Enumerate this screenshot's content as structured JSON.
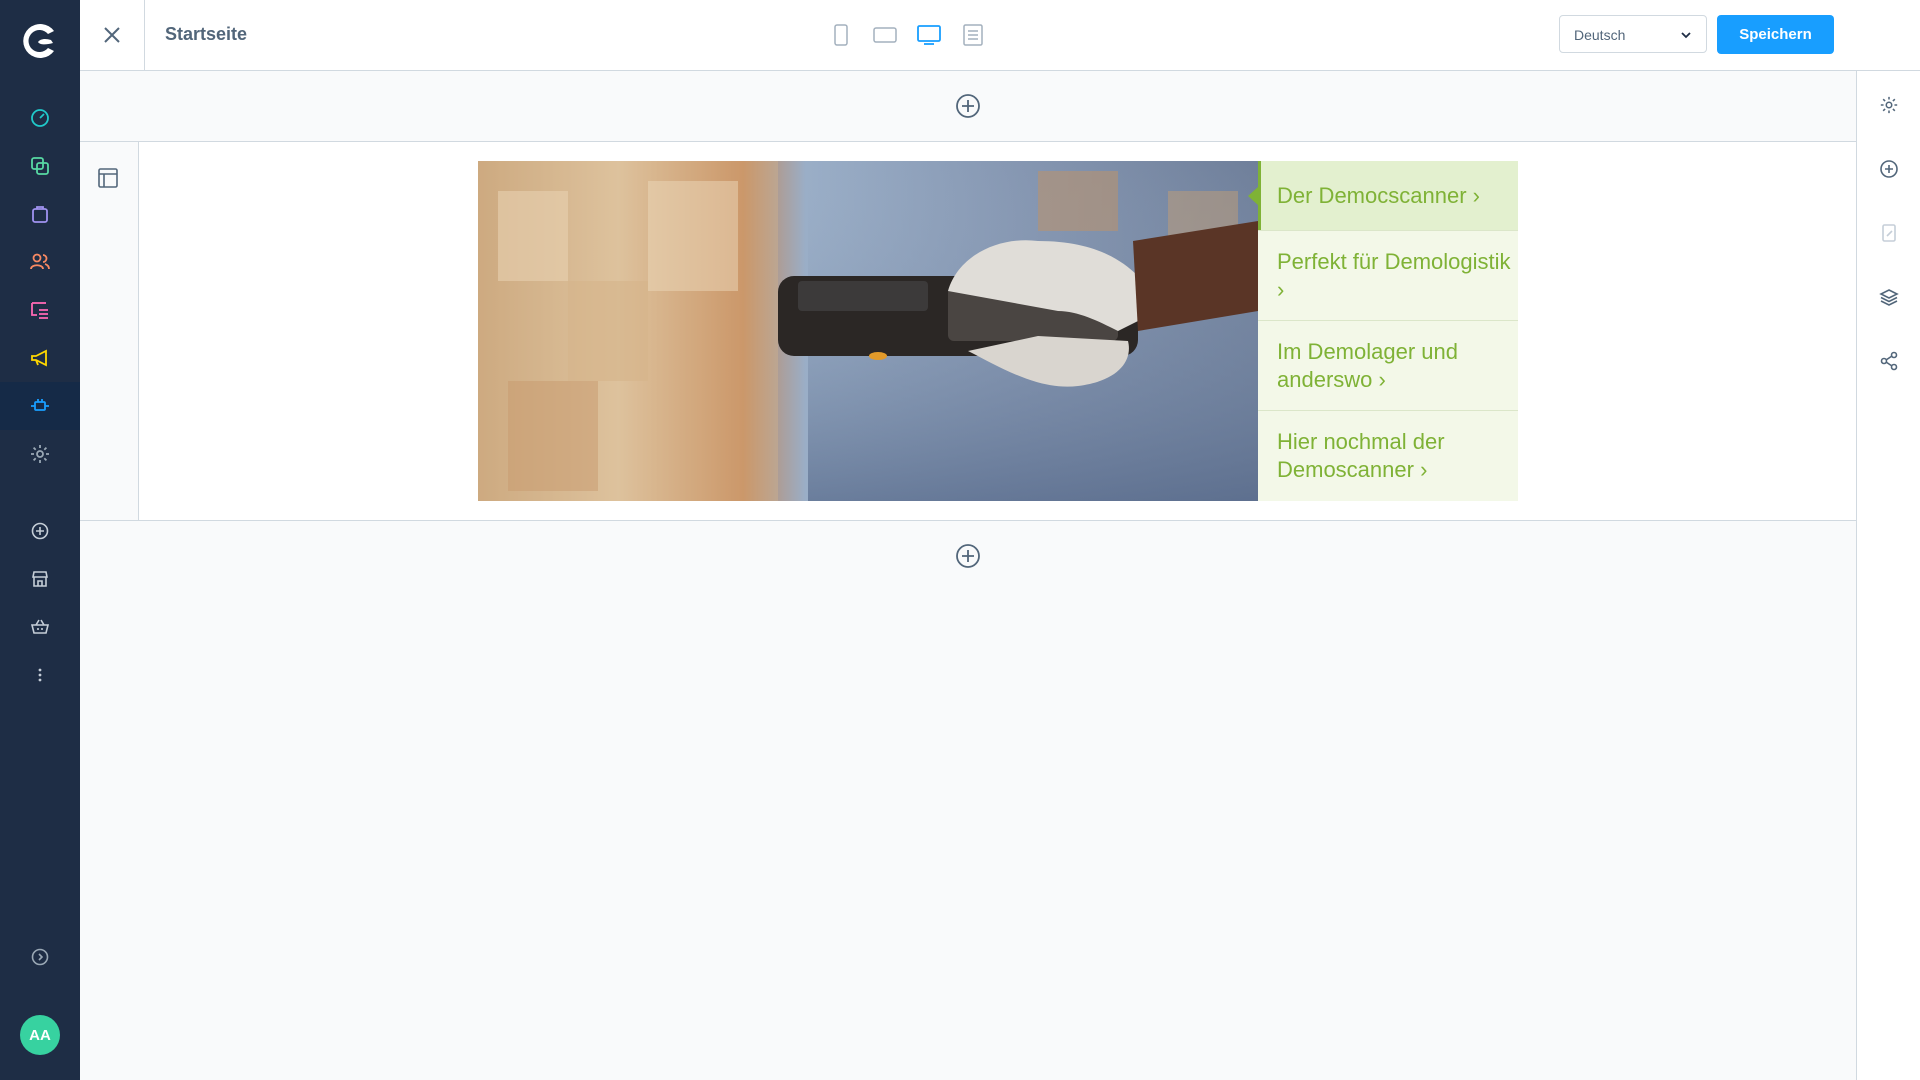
{
  "app": {
    "logo": "shopware-logo",
    "page_title": "Startseite"
  },
  "sidebar": {
    "items": [
      {
        "name": "dashboard",
        "icon": "speedometer-icon",
        "color": "#20c9ca"
      },
      {
        "name": "catalogues",
        "icon": "copy-icon",
        "color": "#57d9a3"
      },
      {
        "name": "orders",
        "icon": "shopping-bag-icon",
        "color": "#a092f0"
      },
      {
        "name": "customers",
        "icon": "users-icon",
        "color": "#f88962"
      },
      {
        "name": "content",
        "icon": "content-list-icon",
        "color": "#ff68b4"
      },
      {
        "name": "marketing",
        "icon": "megaphone-icon",
        "color": "#ffd700"
      },
      {
        "name": "extensions",
        "icon": "plug-icon",
        "color": "#189eff",
        "active": true
      },
      {
        "name": "settings",
        "icon": "gear-icon",
        "color": "#9aa8b5"
      }
    ],
    "secondary": [
      {
        "name": "add",
        "icon": "plus-circle-icon"
      },
      {
        "name": "storefront",
        "icon": "store-icon"
      },
      {
        "name": "basket",
        "icon": "basket-icon"
      },
      {
        "name": "more",
        "icon": "more-vertical-icon"
      }
    ],
    "collapse_icon": "chevron-right-circle-icon",
    "user_initials": "AA"
  },
  "toolbar": {
    "devices": [
      "mobile",
      "tablet-landscape",
      "desktop",
      "form"
    ],
    "active_device": "desktop",
    "language": "Deutsch",
    "save_label": "Speichern"
  },
  "slider": {
    "image_alt": "Handheld-Scanner im Lager",
    "entries": [
      {
        "label": "Der Democscanner ›",
        "active": true
      },
      {
        "label": "Perfekt für Demologistik ›"
      },
      {
        "label": "Im Demolager und anderswo ›"
      },
      {
        "label": "Hier nochmal der Demoscanner ›"
      }
    ]
  },
  "right_panel": {
    "icons": [
      "gear-icon",
      "plus-circle-icon",
      "edit-document-icon",
      "layers-icon",
      "share-icon"
    ]
  },
  "colors": {
    "accent": "#189eff",
    "sidebar_bg": "#1e2d45",
    "slider_green": "#7fb236"
  }
}
